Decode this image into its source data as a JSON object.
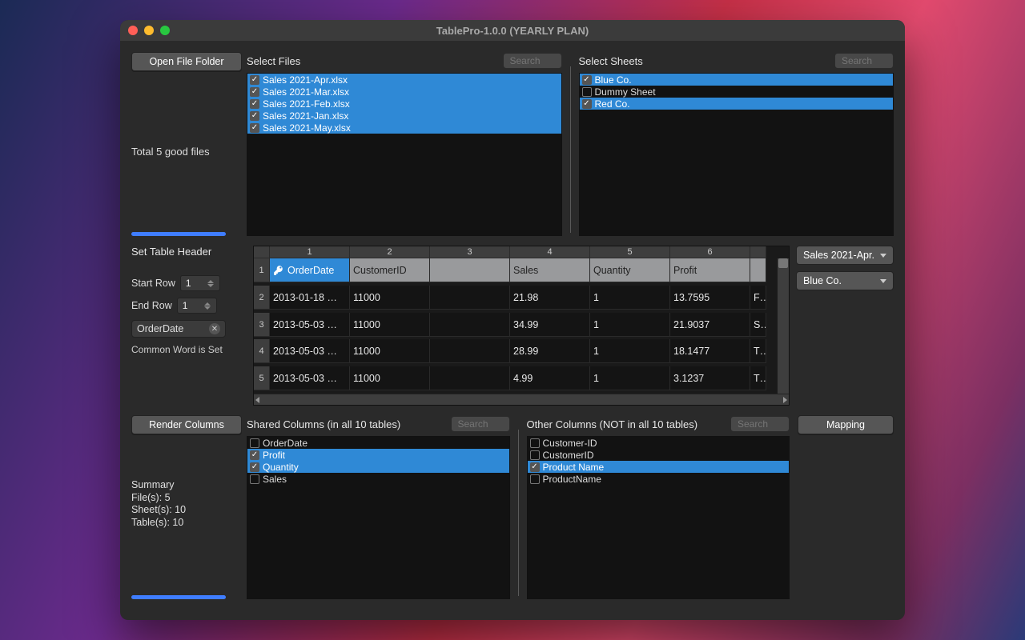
{
  "window": {
    "title": "TablePro-1.0.0 (YEARLY PLAN)"
  },
  "topLeft": {
    "open_button": "Open File Folder",
    "status": "Total 5 good files"
  },
  "files": {
    "label": "Select Files",
    "search_placeholder": "Search",
    "items": [
      {
        "name": "Sales 2021-Apr.xlsx",
        "checked": true,
        "selected": true
      },
      {
        "name": "Sales 2021-Mar.xlsx",
        "checked": true,
        "selected": true
      },
      {
        "name": "Sales 2021-Feb.xlsx",
        "checked": true,
        "selected": true
      },
      {
        "name": "Sales 2021-Jan.xlsx",
        "checked": true,
        "selected": true
      },
      {
        "name": "Sales 2021-May.xlsx",
        "checked": true,
        "selected": true
      }
    ]
  },
  "sheets": {
    "label": "Select Sheets",
    "search_placeholder": "Search",
    "items": [
      {
        "name": "Blue Co.",
        "checked": true,
        "selected": true
      },
      {
        "name": "Dummy Sheet",
        "checked": false,
        "selected": false
      },
      {
        "name": "Red Co.",
        "checked": true,
        "selected": true
      }
    ]
  },
  "header": {
    "label": "Set Table Header",
    "start_row_label": "Start Row",
    "start_row_value": "1",
    "end_row_label": "End Row",
    "end_row_value": "1",
    "chip_label": "OrderDate",
    "common_word": "Common Word is Set"
  },
  "grid": {
    "col_headers": [
      "1",
      "2",
      "3",
      "4",
      "5",
      "6"
    ],
    "field_headers": [
      "OrderDate",
      "CustomerID",
      "",
      "Sales",
      "Quantity",
      "Profit",
      ""
    ],
    "rows": [
      {
        "n": "1"
      },
      {
        "n": "2",
        "cells": [
          "2013-01-18 …",
          "11000",
          "",
          "21.98",
          "1",
          "13.7595",
          "F…"
        ]
      },
      {
        "n": "3",
        "cells": [
          "2013-05-03 …",
          "11000",
          "",
          "34.99",
          "1",
          "21.9037",
          "S…"
        ]
      },
      {
        "n": "4",
        "cells": [
          "2013-05-03 …",
          "11000",
          "",
          "28.99",
          "1",
          "18.1477",
          "T…"
        ]
      },
      {
        "n": "5",
        "cells": [
          "2013-05-03 …",
          "11000",
          "",
          "4.99",
          "1",
          "3.1237",
          "T…"
        ]
      }
    ]
  },
  "selectors": {
    "file": "Sales 2021-Apr.",
    "sheet": "Blue Co."
  },
  "render": {
    "button": "Render Columns",
    "summary_label": "Summary",
    "files_line": "File(s): 5",
    "sheets_line": "Sheet(s): 10",
    "tables_line": "Table(s): 10"
  },
  "shared": {
    "label": "Shared Columns (in all 10 tables)",
    "search_placeholder": "Search",
    "items": [
      {
        "name": "OrderDate",
        "checked": false,
        "selected": false
      },
      {
        "name": "Profit",
        "checked": true,
        "selected": true
      },
      {
        "name": "Quantity",
        "checked": true,
        "selected": true
      },
      {
        "name": "Sales",
        "checked": false,
        "selected": false
      }
    ]
  },
  "other": {
    "label": "Other Columns (NOT in all 10 tables)",
    "search_placeholder": "Search",
    "items": [
      {
        "name": "Customer-ID",
        "checked": false,
        "selected": false
      },
      {
        "name": "CustomerID",
        "checked": false,
        "selected": false
      },
      {
        "name": "Product Name",
        "checked": true,
        "selected": true
      },
      {
        "name": "ProductName",
        "checked": false,
        "selected": false
      }
    ]
  },
  "mapping": {
    "button": "Mapping"
  }
}
